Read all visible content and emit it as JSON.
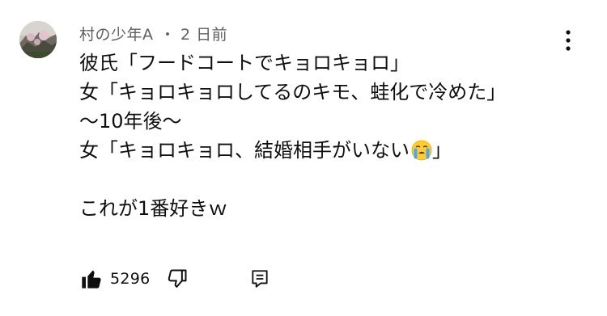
{
  "comment": {
    "author": "村の少年A",
    "separator": "・",
    "timestamp": "2 日前",
    "lines": [
      "彼氏「フードコートでキョロキョロ」",
      "女「キョロキョロしてるのキモ、蛙化で冷めた」",
      "〜10年後〜",
      "女「キョロキョロ、結婚相手がいない",
      "これが1番好きｗ"
    ],
    "line4_end": "」",
    "emoji_name": "loudly-crying-face",
    "like_count": "5296"
  },
  "icons": {
    "like": "thumbs-up-icon",
    "dislike": "thumbs-down-icon",
    "reply": "reply-icon",
    "menu": "more-vertical-icon"
  }
}
